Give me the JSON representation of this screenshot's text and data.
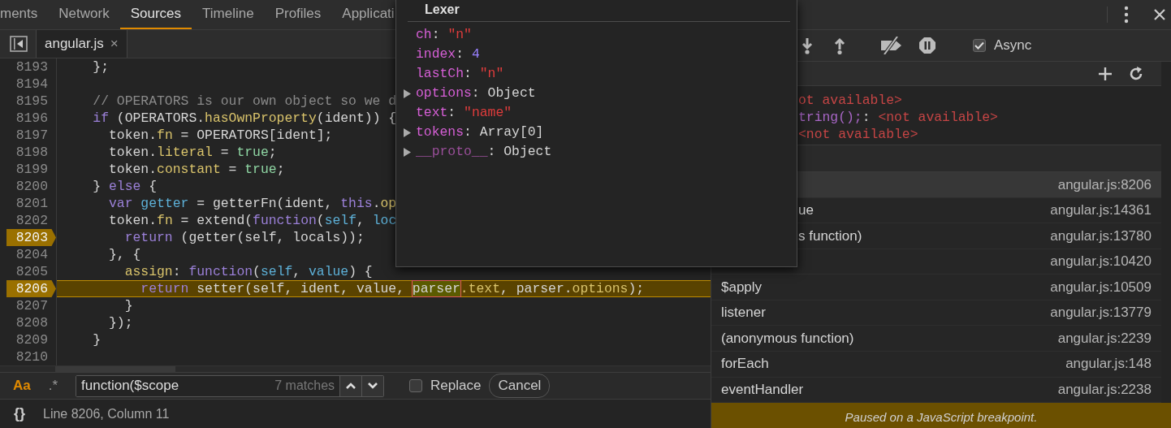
{
  "tabs": [
    {
      "label": "ments",
      "selected": false
    },
    {
      "label": "Network",
      "selected": false
    },
    {
      "label": "Sources",
      "selected": true
    },
    {
      "label": "Timeline",
      "selected": false
    },
    {
      "label": "Profiles",
      "selected": false
    },
    {
      "label": "Applicati",
      "selected": false
    }
  ],
  "file_tabs": [
    {
      "label": "angular.js",
      "close": "×",
      "selected": true
    }
  ],
  "editor": {
    "lines": [
      {
        "number": "8193",
        "breakpoint": false,
        "current": false,
        "tokens": [
          {
            "text": "    };",
            "kind": "p"
          }
        ]
      },
      {
        "number": "8194",
        "breakpoint": false,
        "current": false
      },
      {
        "number": "8195",
        "breakpoint": false,
        "current": false,
        "tokens": [
          {
            "text": "    // OPERATORS is our own object so we d",
            "kind": "c"
          }
        ]
      },
      {
        "number": "8196",
        "breakpoint": false,
        "current": false,
        "tokens": [
          {
            "text": "    if",
            "kind": "k"
          },
          {
            "text": " (OPERATORS.",
            "kind": "p"
          },
          {
            "text": "hasOwnProperty",
            "kind": "a"
          },
          {
            "text": "(ident)) {",
            "kind": "p"
          }
        ]
      },
      {
        "number": "8197",
        "breakpoint": false,
        "current": false,
        "tokens": [
          {
            "text": "      token.",
            "kind": "p"
          },
          {
            "text": "fn",
            "kind": "a"
          },
          {
            "text": " = OPERATORS[ident];",
            "kind": "p"
          }
        ]
      },
      {
        "number": "8198",
        "breakpoint": false,
        "current": false,
        "tokens": [
          {
            "text": "      token.",
            "kind": "p"
          },
          {
            "text": "literal",
            "kind": "a"
          },
          {
            "text": " = ",
            "kind": "p"
          },
          {
            "text": "true",
            "kind": "b"
          },
          {
            "text": ";",
            "kind": "p"
          }
        ]
      },
      {
        "number": "8199",
        "breakpoint": false,
        "current": false,
        "tokens": [
          {
            "text": "      token.",
            "kind": "p"
          },
          {
            "text": "constant",
            "kind": "a"
          },
          {
            "text": " = ",
            "kind": "p"
          },
          {
            "text": "true",
            "kind": "b"
          },
          {
            "text": ";",
            "kind": "p"
          }
        ]
      },
      {
        "number": "8200",
        "breakpoint": false,
        "current": false,
        "tokens": [
          {
            "text": "    } ",
            "kind": "p"
          },
          {
            "text": "else",
            "kind": "k"
          },
          {
            "text": " {",
            "kind": "p"
          }
        ]
      },
      {
        "number": "8201",
        "breakpoint": false,
        "current": false,
        "tokens": [
          {
            "text": "      var",
            "kind": "k"
          },
          {
            "text": " getter",
            "kind": "v"
          },
          {
            "text": " = getterFn(ident, ",
            "kind": "p"
          },
          {
            "text": "this",
            "kind": "k"
          },
          {
            "text": ".",
            "kind": "p"
          },
          {
            "text": "op",
            "kind": "a"
          }
        ]
      },
      {
        "number": "8202",
        "breakpoint": false,
        "current": false,
        "tokens": [
          {
            "text": "      token.",
            "kind": "p"
          },
          {
            "text": "fn",
            "kind": "a"
          },
          {
            "text": " = extend(",
            "kind": "p"
          },
          {
            "text": "function",
            "kind": "k"
          },
          {
            "text": "(",
            "kind": "p"
          },
          {
            "text": "self",
            "kind": "v"
          },
          {
            "text": ", ",
            "kind": "p"
          },
          {
            "text": "loc",
            "kind": "v"
          }
        ]
      },
      {
        "number": "8203",
        "breakpoint": true,
        "current": false,
        "tokens": [
          {
            "text": "        return",
            "kind": "k"
          },
          {
            "text": " (getter(self, locals));",
            "kind": "p"
          }
        ]
      },
      {
        "number": "8204",
        "breakpoint": false,
        "current": false,
        "tokens": [
          {
            "text": "      }, {",
            "kind": "p"
          }
        ]
      },
      {
        "number": "8205",
        "breakpoint": false,
        "current": false,
        "tokens": [
          {
            "text": "        assign",
            "kind": "a"
          },
          {
            "text": ": ",
            "kind": "p"
          },
          {
            "text": "function",
            "kind": "k"
          },
          {
            "text": "(",
            "kind": "p"
          },
          {
            "text": "self",
            "kind": "v"
          },
          {
            "text": ", ",
            "kind": "p"
          },
          {
            "text": "value",
            "kind": "v"
          },
          {
            "text": ") {",
            "kind": "p"
          }
        ]
      },
      {
        "number": "8206",
        "breakpoint": true,
        "current": true,
        "tokens": [
          {
            "text": "          return",
            "kind": "k"
          },
          {
            "text": " setter(self, ident, value, ",
            "kind": "p"
          },
          {
            "text": "parser",
            "kind": "m"
          },
          {
            "text": ".text",
            "kind": "a"
          },
          {
            "text": ", parser.",
            "kind": "p"
          },
          {
            "text": "options",
            "kind": "a"
          },
          {
            "text": ");",
            "kind": "p"
          }
        ]
      },
      {
        "number": "8207",
        "breakpoint": false,
        "current": false,
        "tokens": [
          {
            "text": "        }",
            "kind": "p"
          }
        ]
      },
      {
        "number": "8208",
        "breakpoint": false,
        "current": false,
        "tokens": [
          {
            "text": "      });",
            "kind": "p"
          }
        ]
      },
      {
        "number": "8209",
        "breakpoint": false,
        "current": false,
        "tokens": [
          {
            "text": "    }",
            "kind": "p"
          }
        ]
      },
      {
        "number": "8210",
        "breakpoint": false,
        "current": false
      }
    ]
  },
  "search": {
    "case_label": "Aa",
    "case_sensitive": true,
    "regex_label": ".*",
    "regex": false,
    "value": "function($scope",
    "matches": "7 matches",
    "replace_label": "Replace",
    "replace": false,
    "cancel": "Cancel"
  },
  "status_bar": {
    "pretty_print": "{}",
    "position": "Line 8206, Column 11"
  },
  "debugger": {
    "async_label": "Async",
    "async": true,
    "watch": [
      [
        {
          "text": "ot available>",
          "kind": "error"
        }
      ],
      [
        {
          "text": "tring();",
          "kind": "call"
        },
        {
          "text": ": ",
          "kind": "p"
        },
        {
          "text": "<not available>",
          "kind": "error"
        }
      ],
      [
        {
          "text": "<not available>",
          "kind": "error"
        }
      ]
    ],
    "call_stack": [
      {
        "location": "angular.js:8206",
        "selected": true
      },
      {
        "name": "ue",
        "location": "angular.js:14361",
        "selected": false,
        "clipped": true
      },
      {
        "name": "s function)",
        "location": "angular.js:13780",
        "selected": false,
        "clipped": true
      },
      {
        "location": "angular.js:10420",
        "selected": false
      },
      {
        "name": "$apply",
        "location": "angular.js:10509",
        "selected": false
      },
      {
        "name": "listener",
        "location": "angular.js:13779",
        "selected": false
      },
      {
        "name": "(anonymous function)",
        "location": "angular.js:2239",
        "selected": false
      },
      {
        "name": "forEach",
        "location": "angular.js:148",
        "selected": false
      },
      {
        "name": "eventHandler",
        "location": "angular.js:2238",
        "selected": false
      }
    ],
    "paused_message": "Paused on a JavaScript breakpoint."
  },
  "popover": {
    "title": "Lexer",
    "properties": [
      {
        "name": "ch",
        "separator": ": ",
        "value": "\"n\"",
        "kind": "string",
        "expandable": false,
        "internal": false
      },
      {
        "name": "index",
        "separator": ": ",
        "value": "4",
        "kind": "number",
        "expandable": false,
        "internal": false
      },
      {
        "name": "lastCh",
        "separator": ": ",
        "value": "\"n\"",
        "kind": "string",
        "expandable": false,
        "internal": false
      },
      {
        "name": "options",
        "separator": ": ",
        "value": "Object",
        "kind": "object",
        "expandable": true,
        "internal": false
      },
      {
        "name": "text",
        "separator": ": ",
        "value": "\"name\"",
        "kind": "string",
        "expandable": false,
        "internal": false
      },
      {
        "name": "tokens",
        "separator": ": ",
        "value": "Array[0]",
        "kind": "object",
        "expandable": true,
        "internal": false
      },
      {
        "name": "__proto__",
        "separator": ": ",
        "value": "Object",
        "kind": "object",
        "expandable": true,
        "internal": true
      }
    ]
  }
}
